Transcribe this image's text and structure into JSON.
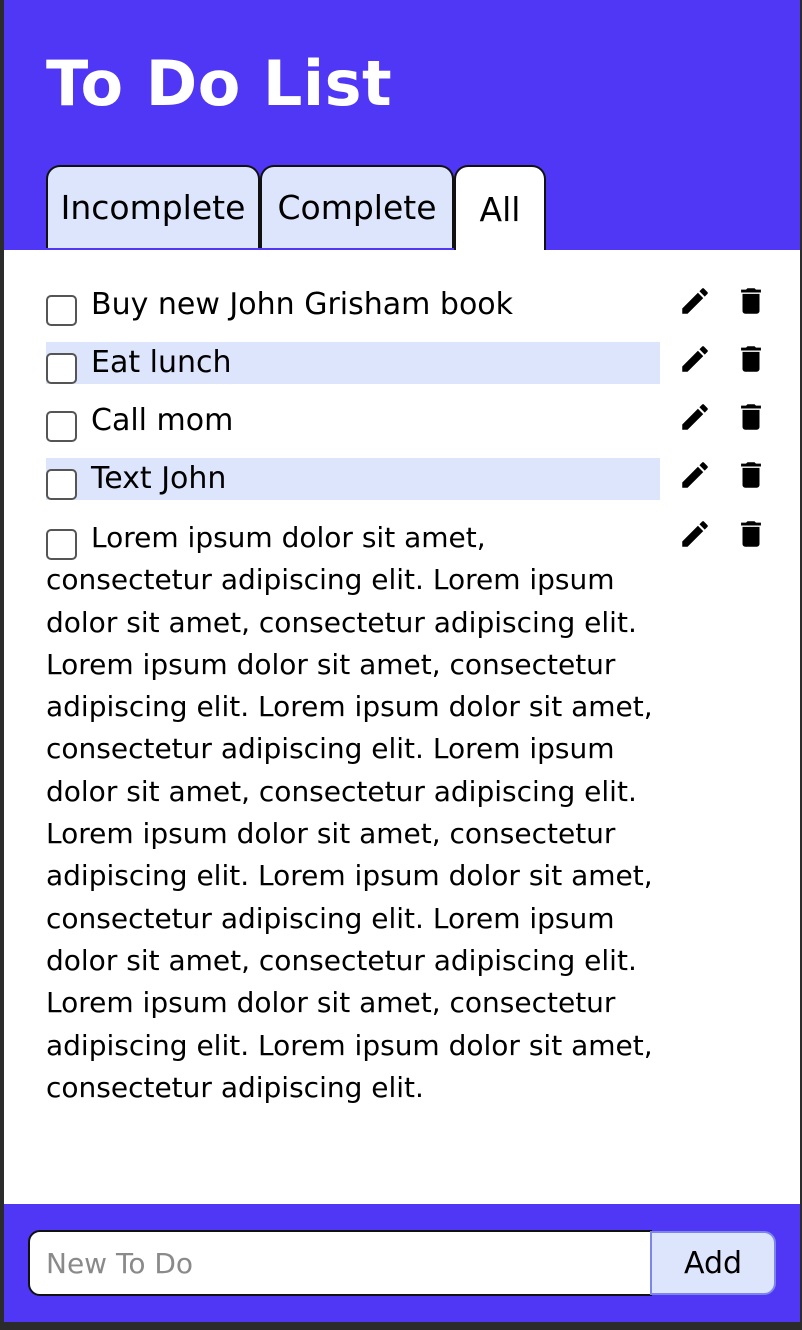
{
  "header": {
    "title": "To Do List"
  },
  "tabs": [
    {
      "label": "Incomplete",
      "active": false
    },
    {
      "label": "Complete",
      "active": false
    },
    {
      "label": "All",
      "active": true
    }
  ],
  "todos": [
    {
      "text": "Buy new John Grisham book",
      "checked": false
    },
    {
      "text": "Eat lunch",
      "checked": false
    },
    {
      "text": "Call mom",
      "checked": false
    },
    {
      "text": "Text John",
      "checked": false
    },
    {
      "text": "Lorem ipsum dolor sit amet, consectetur adipiscing elit. Lorem ipsum dolor sit amet, consectetur adipiscing elit. Lorem ipsum dolor sit amet, consectetur adipiscing elit. Lorem ipsum dolor sit amet, consectetur adipiscing elit. Lorem ipsum dolor sit amet, consectetur adipiscing elit. Lorem ipsum dolor sit amet, consectetur adipiscing elit. Lorem ipsum dolor sit amet, consectetur adipiscing elit. Lorem ipsum dolor sit amet, consectetur adipiscing elit. Lorem ipsum dolor sit amet, consectetur adipiscing elit. Lorem ipsum dolor sit amet, consectetur adipiscing elit.",
      "checked": false
    }
  ],
  "icons": {
    "edit": "pencil-icon",
    "delete": "trash-icon"
  },
  "new_todo": {
    "placeholder": "New To Do",
    "value": ""
  },
  "add_button": {
    "label": "Add"
  },
  "colors": {
    "accent": "#4f37f5",
    "highlight": "#dce5fc",
    "text": "#000000"
  }
}
